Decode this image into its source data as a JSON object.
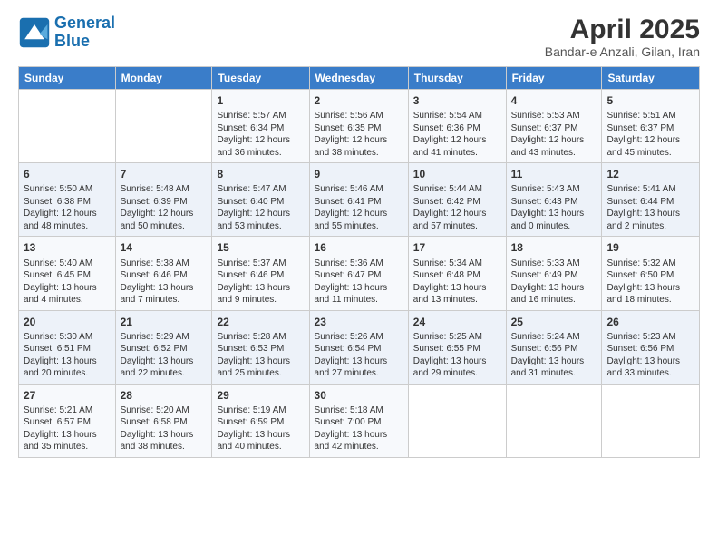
{
  "header": {
    "logo_line1": "General",
    "logo_line2": "Blue",
    "title": "April 2025",
    "subtitle": "Bandar-e Anzali, Gilan, Iran"
  },
  "days_of_week": [
    "Sunday",
    "Monday",
    "Tuesday",
    "Wednesday",
    "Thursday",
    "Friday",
    "Saturday"
  ],
  "weeks": [
    [
      {
        "day": "",
        "sunrise": "",
        "sunset": "",
        "daylight": ""
      },
      {
        "day": "",
        "sunrise": "",
        "sunset": "",
        "daylight": ""
      },
      {
        "day": "1",
        "sunrise": "Sunrise: 5:57 AM",
        "sunset": "Sunset: 6:34 PM",
        "daylight": "Daylight: 12 hours and 36 minutes."
      },
      {
        "day": "2",
        "sunrise": "Sunrise: 5:56 AM",
        "sunset": "Sunset: 6:35 PM",
        "daylight": "Daylight: 12 hours and 38 minutes."
      },
      {
        "day": "3",
        "sunrise": "Sunrise: 5:54 AM",
        "sunset": "Sunset: 6:36 PM",
        "daylight": "Daylight: 12 hours and 41 minutes."
      },
      {
        "day": "4",
        "sunrise": "Sunrise: 5:53 AM",
        "sunset": "Sunset: 6:37 PM",
        "daylight": "Daylight: 12 hours and 43 minutes."
      },
      {
        "day": "5",
        "sunrise": "Sunrise: 5:51 AM",
        "sunset": "Sunset: 6:37 PM",
        "daylight": "Daylight: 12 hours and 45 minutes."
      }
    ],
    [
      {
        "day": "6",
        "sunrise": "Sunrise: 5:50 AM",
        "sunset": "Sunset: 6:38 PM",
        "daylight": "Daylight: 12 hours and 48 minutes."
      },
      {
        "day": "7",
        "sunrise": "Sunrise: 5:48 AM",
        "sunset": "Sunset: 6:39 PM",
        "daylight": "Daylight: 12 hours and 50 minutes."
      },
      {
        "day": "8",
        "sunrise": "Sunrise: 5:47 AM",
        "sunset": "Sunset: 6:40 PM",
        "daylight": "Daylight: 12 hours and 53 minutes."
      },
      {
        "day": "9",
        "sunrise": "Sunrise: 5:46 AM",
        "sunset": "Sunset: 6:41 PM",
        "daylight": "Daylight: 12 hours and 55 minutes."
      },
      {
        "day": "10",
        "sunrise": "Sunrise: 5:44 AM",
        "sunset": "Sunset: 6:42 PM",
        "daylight": "Daylight: 12 hours and 57 minutes."
      },
      {
        "day": "11",
        "sunrise": "Sunrise: 5:43 AM",
        "sunset": "Sunset: 6:43 PM",
        "daylight": "Daylight: 13 hours and 0 minutes."
      },
      {
        "day": "12",
        "sunrise": "Sunrise: 5:41 AM",
        "sunset": "Sunset: 6:44 PM",
        "daylight": "Daylight: 13 hours and 2 minutes."
      }
    ],
    [
      {
        "day": "13",
        "sunrise": "Sunrise: 5:40 AM",
        "sunset": "Sunset: 6:45 PM",
        "daylight": "Daylight: 13 hours and 4 minutes."
      },
      {
        "day": "14",
        "sunrise": "Sunrise: 5:38 AM",
        "sunset": "Sunset: 6:46 PM",
        "daylight": "Daylight: 13 hours and 7 minutes."
      },
      {
        "day": "15",
        "sunrise": "Sunrise: 5:37 AM",
        "sunset": "Sunset: 6:46 PM",
        "daylight": "Daylight: 13 hours and 9 minutes."
      },
      {
        "day": "16",
        "sunrise": "Sunrise: 5:36 AM",
        "sunset": "Sunset: 6:47 PM",
        "daylight": "Daylight: 13 hours and 11 minutes."
      },
      {
        "day": "17",
        "sunrise": "Sunrise: 5:34 AM",
        "sunset": "Sunset: 6:48 PM",
        "daylight": "Daylight: 13 hours and 13 minutes."
      },
      {
        "day": "18",
        "sunrise": "Sunrise: 5:33 AM",
        "sunset": "Sunset: 6:49 PM",
        "daylight": "Daylight: 13 hours and 16 minutes."
      },
      {
        "day": "19",
        "sunrise": "Sunrise: 5:32 AM",
        "sunset": "Sunset: 6:50 PM",
        "daylight": "Daylight: 13 hours and 18 minutes."
      }
    ],
    [
      {
        "day": "20",
        "sunrise": "Sunrise: 5:30 AM",
        "sunset": "Sunset: 6:51 PM",
        "daylight": "Daylight: 13 hours and 20 minutes."
      },
      {
        "day": "21",
        "sunrise": "Sunrise: 5:29 AM",
        "sunset": "Sunset: 6:52 PM",
        "daylight": "Daylight: 13 hours and 22 minutes."
      },
      {
        "day": "22",
        "sunrise": "Sunrise: 5:28 AM",
        "sunset": "Sunset: 6:53 PM",
        "daylight": "Daylight: 13 hours and 25 minutes."
      },
      {
        "day": "23",
        "sunrise": "Sunrise: 5:26 AM",
        "sunset": "Sunset: 6:54 PM",
        "daylight": "Daylight: 13 hours and 27 minutes."
      },
      {
        "day": "24",
        "sunrise": "Sunrise: 5:25 AM",
        "sunset": "Sunset: 6:55 PM",
        "daylight": "Daylight: 13 hours and 29 minutes."
      },
      {
        "day": "25",
        "sunrise": "Sunrise: 5:24 AM",
        "sunset": "Sunset: 6:56 PM",
        "daylight": "Daylight: 13 hours and 31 minutes."
      },
      {
        "day": "26",
        "sunrise": "Sunrise: 5:23 AM",
        "sunset": "Sunset: 6:56 PM",
        "daylight": "Daylight: 13 hours and 33 minutes."
      }
    ],
    [
      {
        "day": "27",
        "sunrise": "Sunrise: 5:21 AM",
        "sunset": "Sunset: 6:57 PM",
        "daylight": "Daylight: 13 hours and 35 minutes."
      },
      {
        "day": "28",
        "sunrise": "Sunrise: 5:20 AM",
        "sunset": "Sunset: 6:58 PM",
        "daylight": "Daylight: 13 hours and 38 minutes."
      },
      {
        "day": "29",
        "sunrise": "Sunrise: 5:19 AM",
        "sunset": "Sunset: 6:59 PM",
        "daylight": "Daylight: 13 hours and 40 minutes."
      },
      {
        "day": "30",
        "sunrise": "Sunrise: 5:18 AM",
        "sunset": "Sunset: 7:00 PM",
        "daylight": "Daylight: 13 hours and 42 minutes."
      },
      {
        "day": "",
        "sunrise": "",
        "sunset": "",
        "daylight": ""
      },
      {
        "day": "",
        "sunrise": "",
        "sunset": "",
        "daylight": ""
      },
      {
        "day": "",
        "sunrise": "",
        "sunset": "",
        "daylight": ""
      }
    ]
  ]
}
